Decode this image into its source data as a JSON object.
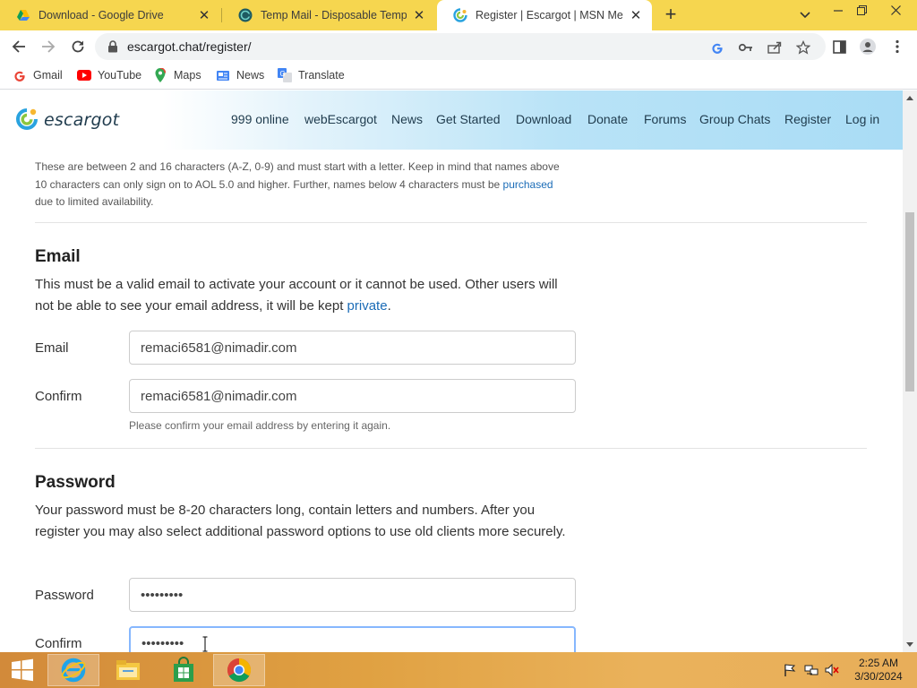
{
  "browser": {
    "tabs": [
      {
        "title": "Download - Google Drive",
        "icon": "google-drive-icon"
      },
      {
        "title": "Temp Mail - Disposable Temporary Email",
        "icon": "temp-mail-icon"
      },
      {
        "title": "Register | Escargot | MSN Messenger",
        "icon": "escargot-icon",
        "active": true
      }
    ],
    "address": "escargot.chat/register/",
    "bookmarks": [
      {
        "label": "Gmail",
        "icon": "google-icon"
      },
      {
        "label": "YouTube",
        "icon": "youtube-icon"
      },
      {
        "label": "Maps",
        "icon": "maps-icon"
      },
      {
        "label": "News",
        "icon": "news-icon"
      },
      {
        "label": "Translate",
        "icon": "translate-icon"
      }
    ]
  },
  "site": {
    "brand": "escargot",
    "nav": [
      "999 online",
      "webEscargot",
      "News",
      "Get Started",
      "Download",
      "Donate",
      "Forums",
      "Group Chats",
      "Register",
      "Log in"
    ]
  },
  "username_note": {
    "text1": "These are between 2 and 16 characters (A-Z, 0-9) and must start with a letter. Keep in mind that names above 10 characters can only sign on to AOL 5.0 and higher. Further, names below 4 characters must be ",
    "link": "purchased",
    "text2": " due to limited availability."
  },
  "email_section": {
    "heading": "Email",
    "desc1": "This must be a valid email to activate your account or it cannot be used. Other users will not be able to see your email address, it will be kept ",
    "desc_link": "private",
    "desc2": ".",
    "email_label": "Email",
    "email_value": "remaci6581@nimadir.com",
    "confirm_label": "Confirm",
    "confirm_value": "remaci6581@nimadir.com",
    "helper": "Please confirm your email address by entering it again."
  },
  "password_section": {
    "heading": "Password",
    "desc": "Your password must be 8-20 characters long, contain letters and numbers. After you register you may also select additional password options to use old clients more securely.",
    "password_label": "Password",
    "password_value": "•••••••••",
    "confirm_label": "Confirm",
    "confirm_value": "•••••••••"
  },
  "taskbar": {
    "apps": [
      "start-button",
      "internet-explorer-icon",
      "file-explorer-icon",
      "store-icon",
      "chrome-icon"
    ],
    "time": "2:25 AM",
    "date": "3/30/2024"
  }
}
